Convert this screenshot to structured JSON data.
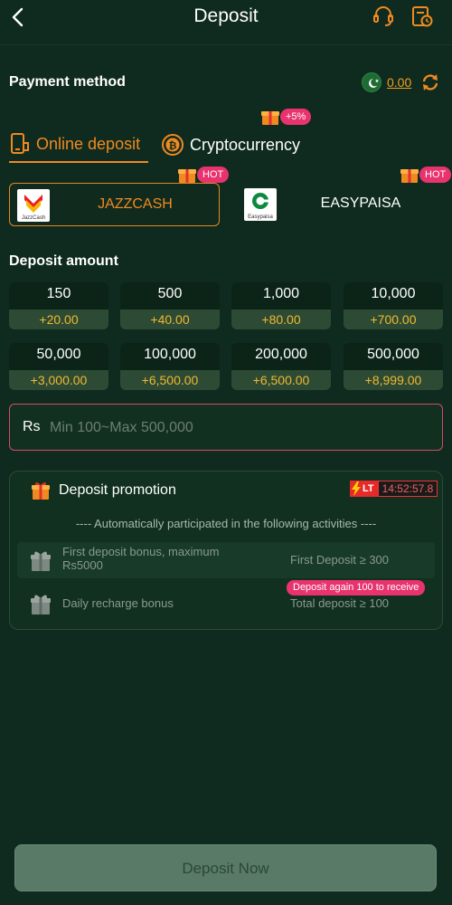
{
  "header": {
    "title": "Deposit"
  },
  "payment": {
    "label": "Payment method",
    "balance": "0.00"
  },
  "tabs": [
    {
      "label": "Online deposit"
    },
    {
      "label": "Cryptocurrency",
      "badge": "+5%"
    }
  ],
  "methods": [
    {
      "name": "JAZZCASH",
      "logo_text": "JazzCash",
      "badge": "HOT"
    },
    {
      "name": "EASYPAISA",
      "logo_text": "Easypaisa",
      "badge": "HOT"
    }
  ],
  "amount_section": {
    "label": "Deposit amount"
  },
  "amounts": [
    {
      "value": "150",
      "bonus": "+20.00"
    },
    {
      "value": "500",
      "bonus": "+40.00"
    },
    {
      "value": "1,000",
      "bonus": "+80.00"
    },
    {
      "value": "10,000",
      "bonus": "+700.00"
    },
    {
      "value": "50,000",
      "bonus": "+3,000.00"
    },
    {
      "value": "100,000",
      "bonus": "+6,500.00"
    },
    {
      "value": "200,000",
      "bonus": "+6,500.00"
    },
    {
      "value": "500,000",
      "bonus": "+8,999.00"
    }
  ],
  "input": {
    "currency": "Rs",
    "placeholder": "Min 100~Max 500,000"
  },
  "promotion": {
    "title": "Deposit promotion",
    "badge": "LT",
    "timer": "14:52:57.8",
    "subtitle": "---- Automatically participated in the following activities ----",
    "items": [
      {
        "name": "First deposit bonus, maximum Rs5000",
        "condition": "First Deposit ≥ 300"
      },
      {
        "name": "Daily recharge bonus",
        "condition": "Total deposit ≥ 100",
        "note": "Deposit again 100 to receive"
      }
    ]
  },
  "submit": {
    "label": "Deposit Now"
  },
  "colors": {
    "accent": "#f08a20",
    "bonus": "#f0b830",
    "hot": "#e8336f",
    "background": "#0f2a1f"
  }
}
